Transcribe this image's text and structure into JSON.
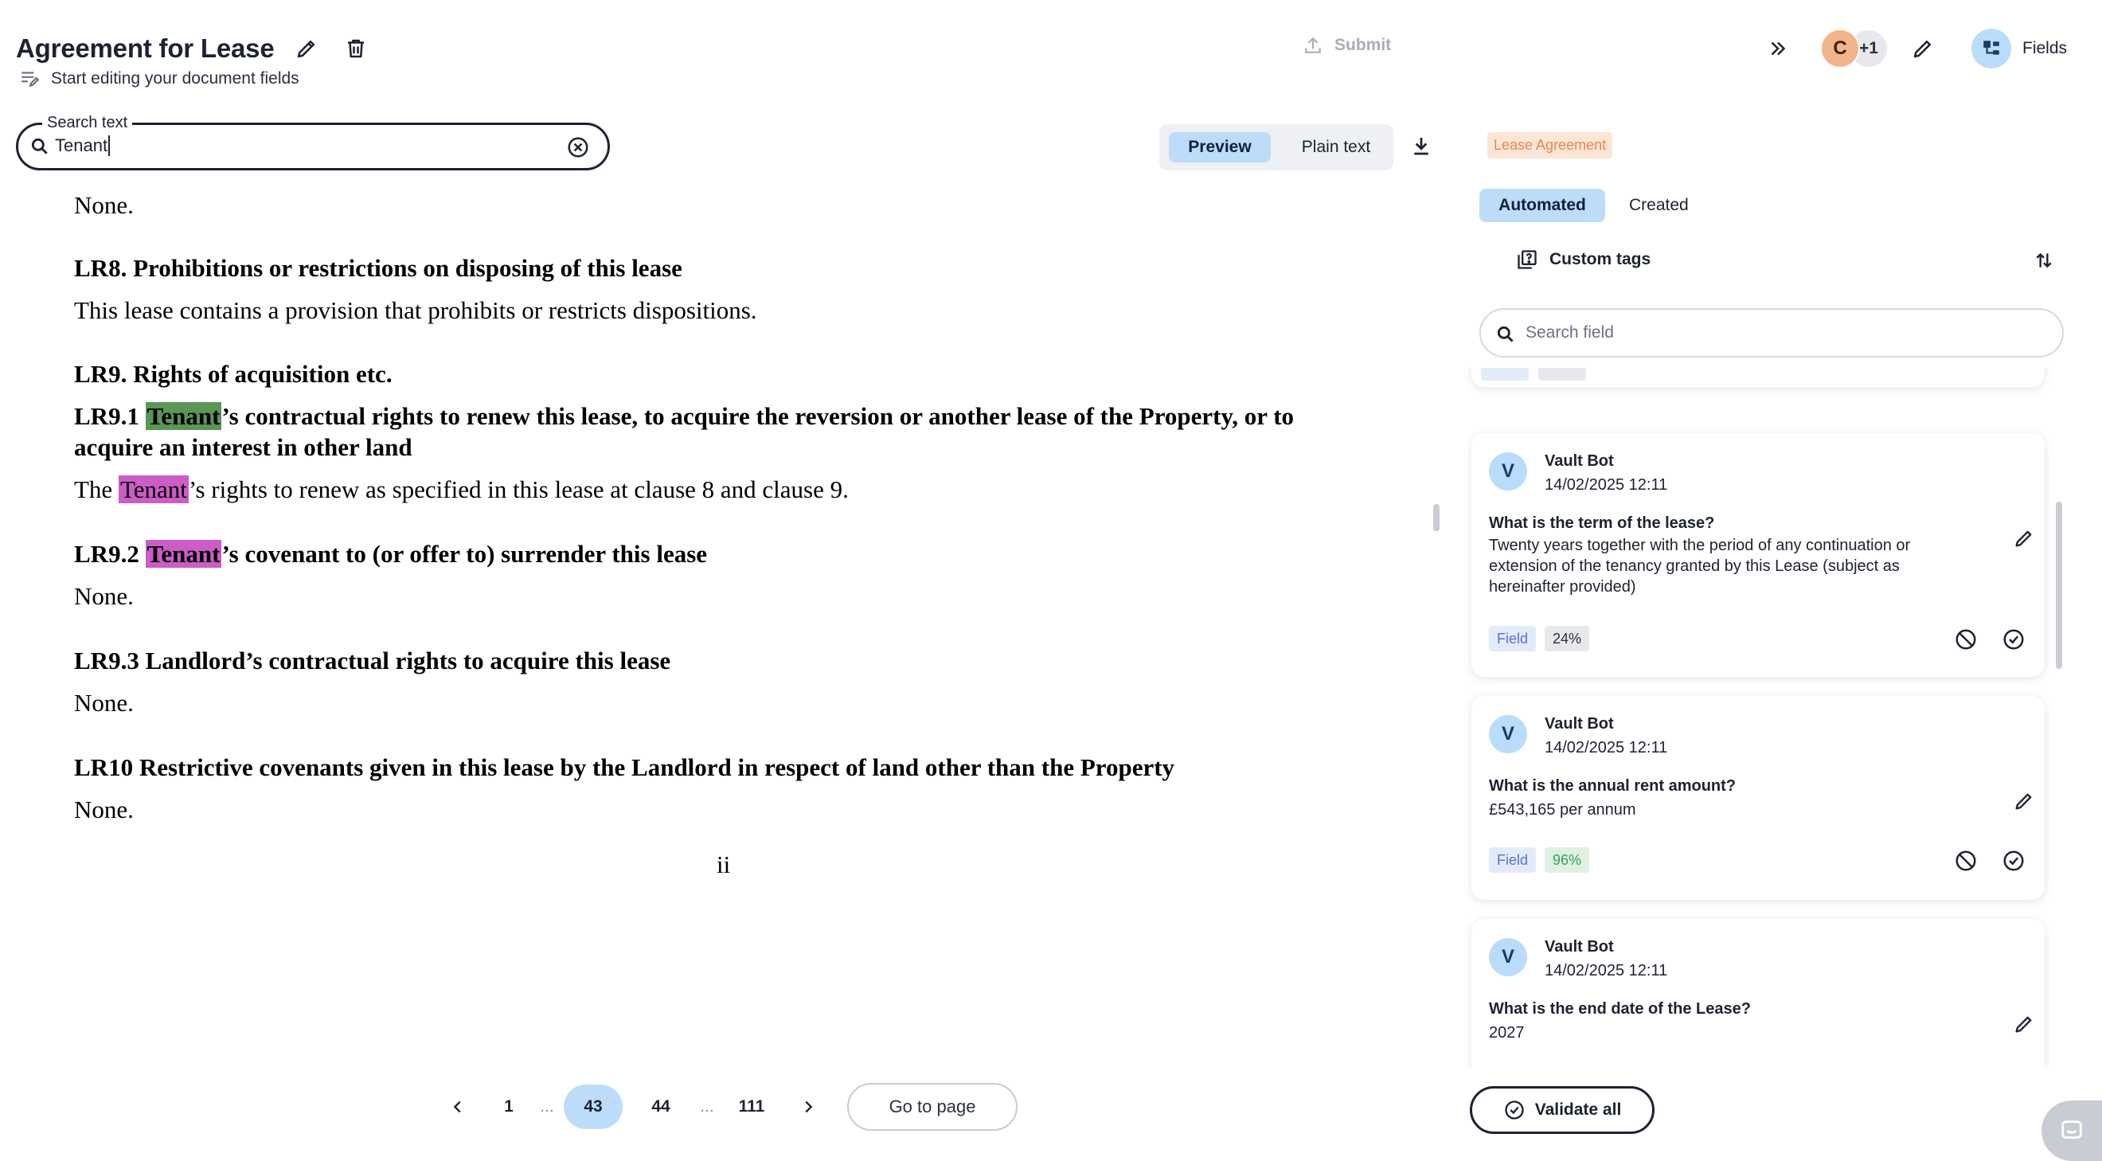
{
  "header": {
    "title": "Agreement for Lease",
    "subtitle": "Start editing your document fields",
    "submit_label": "Submit",
    "avatar_initial": "C",
    "avatar_more": "+1",
    "fields_label": "Fields"
  },
  "search": {
    "legend": "Search text",
    "value": "Tenant"
  },
  "view_toggle": {
    "preview_label": "Preview",
    "plain_label": "Plain text",
    "active": "Preview"
  },
  "document": {
    "l1": "None.",
    "l2": "LR8. Prohibitions or restrictions on disposing of this lease",
    "l3": "This lease contains a provision that prohibits or restricts dispositions.",
    "l4": "LR9. Rights of acquisition etc.",
    "l5_prefix": "LR9.1 ",
    "l5_match": "Tenant",
    "l5_suffix": "’s contractual rights to renew this lease, to acquire the reversion or another lease of the Property, or to",
    "l6": "acquire an interest in other land",
    "l7_prefix": "The ",
    "l7_match": "Tenant",
    "l7_suffix": "’s rights to renew as specified in this lease at clause 8 and clause 9.",
    "l8_prefix": "LR9.2 ",
    "l8_match": "Tenant",
    "l8_suffix": "’s covenant to (or offer to) surrender this lease",
    "l9": "None.",
    "l10": "LR9.3 Landlord’s contractual rights to acquire this lease",
    "l11": "None.",
    "l12": "LR10 Restrictive covenants given in this lease by the Landlord in respect of land other than the Property",
    "l13": "None.",
    "page_number": "ii"
  },
  "pagination": {
    "first": "1",
    "dots_left": "...",
    "current": "43",
    "next_page": "44",
    "dots_right": "...",
    "last": "111",
    "goto_label": "Go to page"
  },
  "panel": {
    "doc_type": "Lease Agreement",
    "tab_automated": "Automated",
    "tab_created": "Created",
    "custom_tags_label": "Custom tags",
    "field_search_placeholder": "Search field",
    "cards": [
      {
        "avatar": "V",
        "author": "Vault Bot",
        "time": "14/02/2025 12:11",
        "question": "What is the term of the lease?",
        "answer": "Twenty years together with the period of any continuation or extension of the tenancy granted by this Lease (subject as hereinafter provided)",
        "tag": "Field",
        "confidence": "24%"
      },
      {
        "avatar": "V",
        "author": "Vault Bot",
        "time": "14/02/2025 12:11",
        "question": "What is the annual rent amount?",
        "answer": "£543,165 per annum",
        "tag": "Field",
        "confidence": "96%"
      },
      {
        "avatar": "V",
        "author": "Vault Bot",
        "time": "14/02/2025 12:11",
        "question": "What is the end date of the Lease?",
        "answer": "2027"
      }
    ],
    "validate_all_label": "Validate all"
  },
  "colors": {
    "accent_blue": "#bcdcfa",
    "highlight_current": "#5a9656",
    "highlight_other": "#cc5cc6",
    "confidence_high": "#36a05a"
  },
  "icons": [
    "pencil-icon",
    "trash-icon",
    "edit-doc-icon",
    "upload-icon",
    "double-chevron-right-icon",
    "fields-tree-icon",
    "search-icon",
    "clear-circle-icon",
    "download-icon",
    "chevron-left-icon",
    "chevron-right-icon",
    "custom-tags-icon",
    "sort-icon",
    "reject-icon",
    "accept-check-icon",
    "chat-icon"
  ]
}
